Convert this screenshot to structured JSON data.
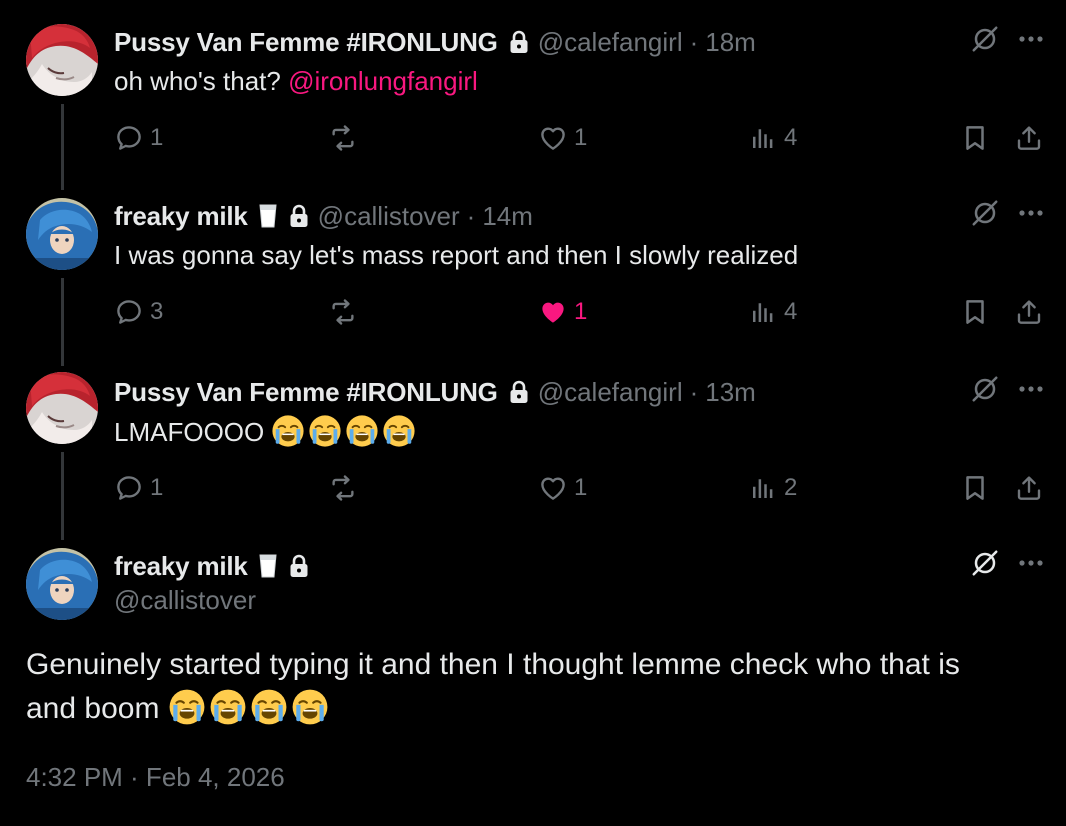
{
  "posts": [
    {
      "name": "Pussy Van Femme #IRONLUNG",
      "handle": "@calefangirl",
      "separator": "·",
      "time": "18m",
      "text": "oh who's that? ",
      "mention": "@ironlungfangirl",
      "replies": "1",
      "reposts": "",
      "likes": "1",
      "views": "4",
      "liked": false
    },
    {
      "name": "freaky milk",
      "handle": "@callistover",
      "separator": "·",
      "time": "14m",
      "text": "I was gonna say let's mass report and then I slowly realized",
      "replies": "3",
      "reposts": "",
      "likes": "1",
      "views": "4",
      "liked": true
    },
    {
      "name": "Pussy Van Femme #IRONLUNG",
      "handle": "@calefangirl",
      "separator": "·",
      "time": "13m",
      "text": "LMAFOOOO ",
      "replies": "1",
      "reposts": "",
      "likes": "1",
      "views": "2",
      "liked": false
    }
  ],
  "main_post": {
    "name": "freaky milk",
    "handle": "@callistover",
    "text_line1": "Genuinely started typing it and then I thought lemme check who that is",
    "text_line2": "and boom ",
    "timestamp": "4:32 PM · Feb 4, 2026"
  },
  "colors": {
    "background": "#000000",
    "text": "#e7e9ea",
    "muted": "#71767b",
    "accent_pink": "#f91880",
    "connector": "#333639"
  },
  "icons": {
    "reply": "reply-icon",
    "repost": "repost-icon",
    "like": "heart-icon",
    "views": "views-icon",
    "bookmark": "bookmark-icon",
    "share": "share-icon",
    "grok": "grok-icon",
    "more": "more-icon",
    "lock": "lock-icon",
    "milk": "milk-glass-icon",
    "emoji": "loudly-crying-face-emoji"
  }
}
